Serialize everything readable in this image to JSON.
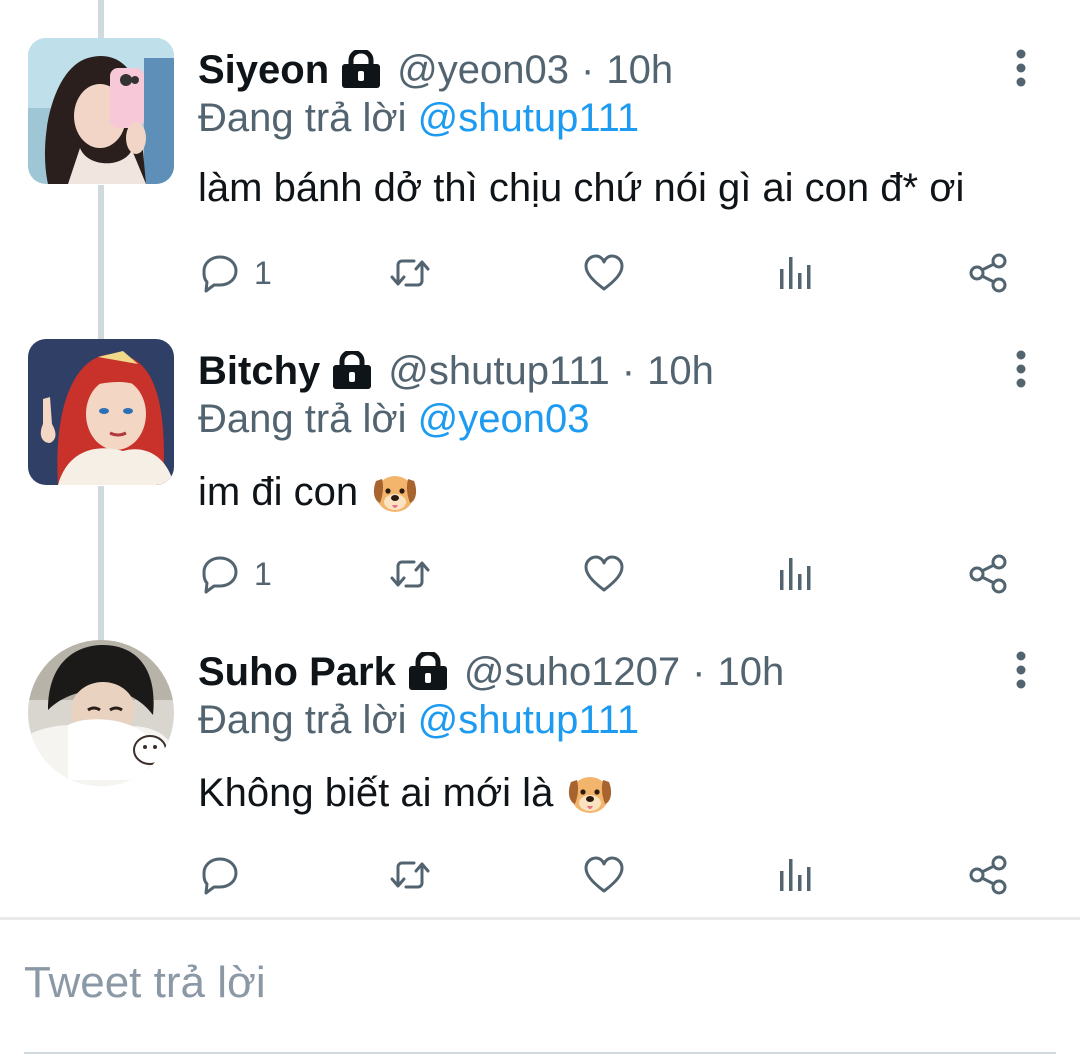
{
  "tweets": [
    {
      "name": "Siyeon",
      "handle": "@yeon03",
      "dot": "·",
      "time": "10h",
      "replying_prefix": "Đang trả lời",
      "replying_to": "@shutup111",
      "text": "làm bánh dở thì chịu chứ nói gì ai con đ* ơi",
      "has_emoji": false,
      "reply_count": "1"
    },
    {
      "name": "Bitchy",
      "handle": "@shutup111",
      "dot": "·",
      "time": "10h",
      "replying_prefix": "Đang trả lời",
      "replying_to": "@yeon03",
      "text": "im đi con",
      "has_emoji": true,
      "emoji": "dog-face",
      "reply_count": "1"
    },
    {
      "name": "Suho Park",
      "handle": "@suho1207",
      "dot": "·",
      "time": "10h",
      "replying_prefix": "Đang trả lời",
      "replying_to": "@shutup111",
      "text": "Không biết ai mới là",
      "has_emoji": true,
      "emoji": "dog-face",
      "reply_count": ""
    }
  ],
  "reply_box": {
    "placeholder": "Tweet trả lời"
  },
  "icons": {
    "lock": "lock-icon",
    "more": "more-vertical-icon",
    "reply": "reply-icon",
    "retweet": "retweet-icon",
    "like": "heart-icon",
    "views": "views-icon",
    "share": "share-icon"
  },
  "colors": {
    "text": "#0f1419",
    "secondary": "#536471",
    "link": "#1d9bf0",
    "thread_line": "#cfd9de"
  }
}
